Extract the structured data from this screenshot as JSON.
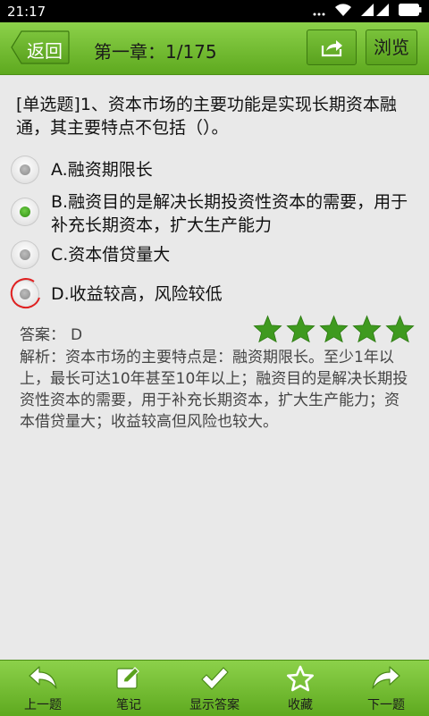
{
  "status_bar": {
    "time": "21:17",
    "icons": [
      "signal-bars-icon",
      "wifi-icon",
      "cell-signal-icon",
      "battery-icon"
    ]
  },
  "header": {
    "back_label": "返回",
    "chapter_label": "第一章：1/175",
    "share_icon": "share-icon",
    "browse_label": "浏览",
    "bar_color": "#6bbd2a"
  },
  "question": {
    "text": "[单选题]1、资本市场的主要功能是实现长期资本融通，其主要特点不包括（）。",
    "options": [
      {
        "label": "A.融资期限长",
        "selected": false
      },
      {
        "label": "B.融资目的是解决长期投资性资本的需要，用于补充长期资本，扩大生产能力",
        "selected": true
      },
      {
        "label": "C.资本借贷量大",
        "selected": false
      },
      {
        "label": "D.收益较高，风险较低",
        "selected": false,
        "highlighted": true
      }
    ]
  },
  "answer": {
    "label": "答案：",
    "value": "D",
    "rating": 5,
    "star_color": "#3f9a1f"
  },
  "analysis": {
    "text": "解析：资本市场的主要特点是：融资期限长。至少1年以上，最长可达10年甚至10年以上；融资目的是解决长期投资性资本的需要，用于补充长期资本，扩大生产能力；资本借贷量大；收益较高但风险也较大。"
  },
  "bottom_nav": {
    "items": [
      {
        "label": "上一题",
        "icon": "undo-arrow-icon"
      },
      {
        "label": "笔记",
        "icon": "edit-note-icon"
      },
      {
        "label": "显示答案",
        "icon": "checkmark-icon"
      },
      {
        "label": "收藏",
        "icon": "star-outline-icon"
      },
      {
        "label": "下一题",
        "icon": "redo-arrow-icon"
      }
    ]
  }
}
